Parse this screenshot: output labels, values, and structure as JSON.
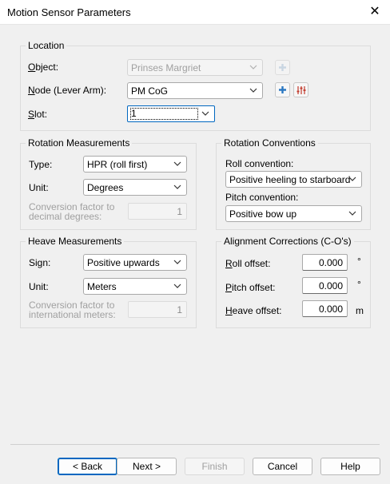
{
  "window": {
    "title": "Motion Sensor Parameters",
    "close_glyph": "✕"
  },
  "location": {
    "title": "Location",
    "object_label": "Object:",
    "object_value": "Prinses Margriet",
    "node_label": "Node (Lever Arm):",
    "node_value": "PM CoG",
    "slot_label": "Slot:",
    "slot_value": "1"
  },
  "rotation_measurements": {
    "title": "Rotation Measurements",
    "type_label": "Type:",
    "type_value": "HPR (roll first)",
    "unit_label": "Unit:",
    "unit_value": "Degrees",
    "conversion_label": "Conversion factor to decimal degrees:",
    "conversion_value": "1"
  },
  "rotation_conventions": {
    "title": "Rotation Conventions",
    "roll_label": "Roll convention:",
    "roll_value": "Positive heeling to starboard",
    "pitch_label": "Pitch convention:",
    "pitch_value": "Positive bow up"
  },
  "heave_measurements": {
    "title": "Heave Measurements",
    "sign_label": "Sign:",
    "sign_value": "Positive upwards",
    "unit_label": "Unit:",
    "unit_value": "Meters",
    "conversion_label": "Conversion factor to international meters:",
    "conversion_value": "1"
  },
  "alignment_corrections": {
    "title": "Alignment Corrections (C-O's)",
    "roll_label": "Roll offset:",
    "roll_value": "0.000",
    "roll_unit": "°",
    "pitch_label": "Pitch offset:",
    "pitch_value": "0.000",
    "pitch_unit": "°",
    "heave_label": "Heave offset:",
    "heave_value": "0.000",
    "heave_unit": "m"
  },
  "buttons": {
    "back": "< Back",
    "next": "Next >",
    "finish": "Finish",
    "cancel": "Cancel",
    "help": "Help"
  },
  "icons": {
    "add": "plus-icon",
    "adjust": "sliders-icon",
    "dropdown": "chevron-down-icon"
  },
  "colors": {
    "accent": "#0067c0",
    "add_icon": "#2b78c2",
    "adjust_icon": "#c0392b"
  }
}
